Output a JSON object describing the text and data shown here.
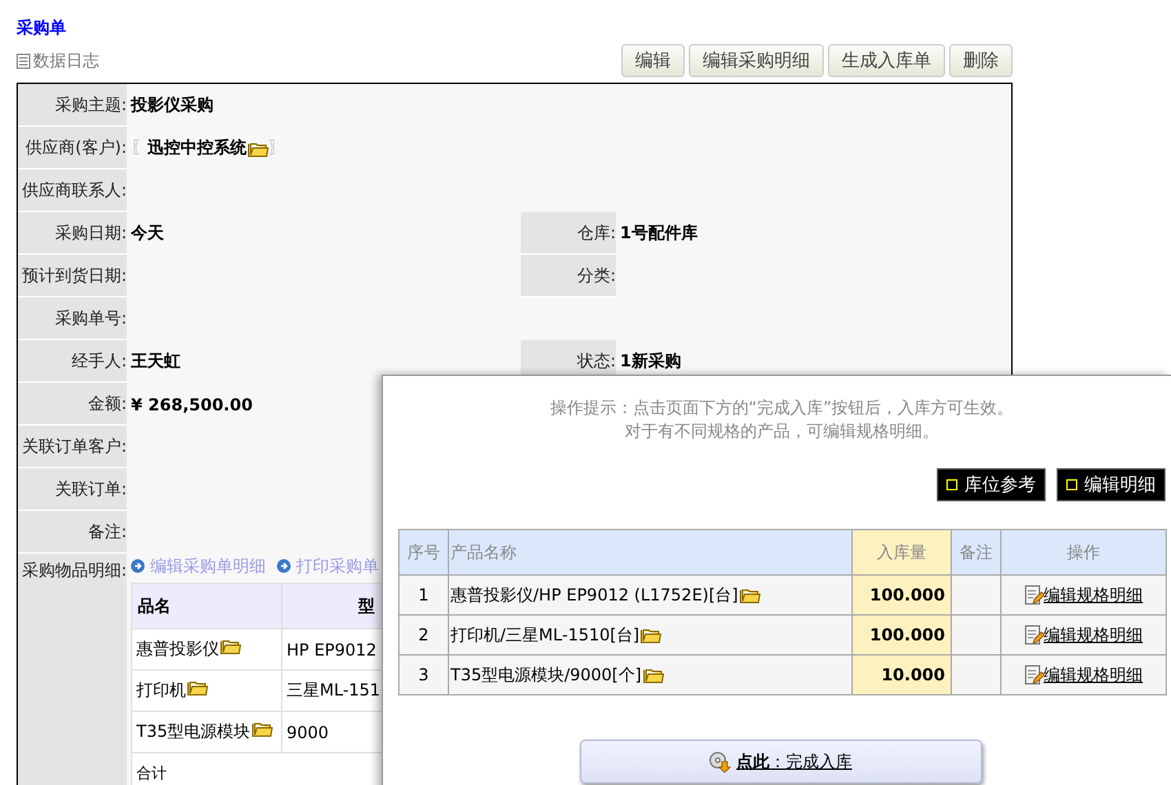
{
  "page": {
    "title": "采购单",
    "log_link": "数据日志"
  },
  "actions": [
    "编辑",
    "编辑采购明细",
    "生成入库单",
    "删除"
  ],
  "form": {
    "rows": [
      {
        "kind": "text",
        "label": "采购主题:",
        "value": "投影仪采购"
      },
      {
        "kind": "supplier",
        "label": "供应商(客户):",
        "value": "迅控中控系统",
        "bracket_open": "〖",
        "bracket_close": "〗"
      },
      {
        "kind": "text",
        "label": "供应商联系人:"
      },
      {
        "kind": "text",
        "label": "采购日期:",
        "value": "今天",
        "right": {
          "label": "仓库:",
          "value": "1号配件库"
        }
      },
      {
        "kind": "text",
        "label": "预计到货日期:",
        "right": {
          "label": "分类:"
        }
      },
      {
        "kind": "text",
        "label": "采购单号:"
      },
      {
        "kind": "text",
        "label": "经手人:",
        "value": "王天虹",
        "right": {
          "label": "状态:",
          "value": "1新采购"
        }
      },
      {
        "kind": "text",
        "label": "金额:",
        "value": "¥ 268,500.00"
      },
      {
        "kind": "text",
        "label": "关联订单客户:"
      },
      {
        "kind": "text",
        "label": "关联订单:"
      },
      {
        "kind": "text",
        "label": "备注:"
      }
    ]
  },
  "items_section": {
    "label": "采购物品明细:",
    "links": [
      "编辑采购单明细",
      "打印采购单"
    ],
    "columns": [
      "品名",
      "型"
    ],
    "rows": [
      {
        "name": "惠普投影仪",
        "model": "HP EP9012"
      },
      {
        "name": "打印机",
        "model": "三星ML-151"
      },
      {
        "name": "T35型电源模块",
        "model": "9000"
      }
    ],
    "total_label": "合计"
  },
  "dialog": {
    "tip_lines": [
      "操作提示：点击页面下方的“完成入库”按钮后，入库方可生效。",
      "对于有不同规格的产品，可编辑规格明细。"
    ],
    "buttons": [
      "库位参考",
      "编辑明细"
    ],
    "columns": [
      "序号",
      "产品名称",
      "入库量",
      "备注",
      "操作"
    ],
    "rows": [
      {
        "no": "1",
        "product": "惠普投影仪/HP EP9012 (L1752E)[台]",
        "qty": "100.000",
        "action": "编辑规格明细"
      },
      {
        "no": "2",
        "product": "打印机/三星ML-1510[台]",
        "qty": "100.000",
        "action": "编辑规格明细"
      },
      {
        "no": "3",
        "product": "T35型电源模块/9000[个]",
        "qty": "10.000",
        "action": "编辑规格明细"
      }
    ],
    "submit": "**点此**：完成入库"
  }
}
